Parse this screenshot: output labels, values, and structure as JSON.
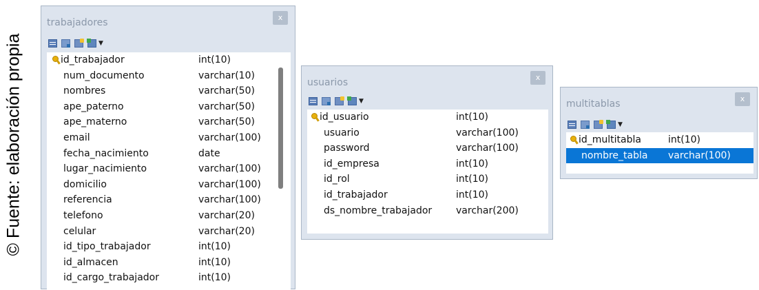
{
  "credit": "© Fuente: elaboración propia",
  "tables": [
    {
      "title": "trabajadores",
      "close": "x",
      "fields": [
        {
          "name": "id_trabajador",
          "type": "int(10)"
        },
        {
          "name": "num_documento",
          "type": "varchar(10)"
        },
        {
          "name": "nombres",
          "type": "varchar(50)"
        },
        {
          "name": "ape_paterno",
          "type": "varchar(50)"
        },
        {
          "name": "ape_materno",
          "type": "varchar(50)"
        },
        {
          "name": "email",
          "type": "varchar(100)"
        },
        {
          "name": "fecha_nacimiento",
          "type": "date"
        },
        {
          "name": "lugar_nacimiento",
          "type": "varchar(100)"
        },
        {
          "name": "domicilio",
          "type": "varchar(100)"
        },
        {
          "name": "referencia",
          "type": "varchar(100)"
        },
        {
          "name": "telefono",
          "type": "varchar(20)"
        },
        {
          "name": "celular",
          "type": "varchar(20)"
        },
        {
          "name": "id_tipo_trabajador",
          "type": "int(10)"
        },
        {
          "name": "id_almacen",
          "type": "int(10)"
        },
        {
          "name": "id_cargo_trabajador",
          "type": "int(10)"
        }
      ]
    },
    {
      "title": "usuarios",
      "close": "x",
      "fields": [
        {
          "name": "id_usuario",
          "type": "int(10)"
        },
        {
          "name": "usuario",
          "type": "varchar(100)"
        },
        {
          "name": "password",
          "type": "varchar(100)"
        },
        {
          "name": "id_empresa",
          "type": "int(10)"
        },
        {
          "name": "id_rol",
          "type": "int(10)"
        },
        {
          "name": "id_trabajador",
          "type": "int(10)"
        },
        {
          "name": "ds_nombre_trabajador",
          "type": "varchar(200)"
        }
      ]
    },
    {
      "title": "multitablas",
      "close": "x",
      "fields": [
        {
          "name": "id_multitabla",
          "type": "int(10)"
        },
        {
          "name": "nombre_tabla",
          "type": "varchar(100)"
        }
      ]
    }
  ]
}
